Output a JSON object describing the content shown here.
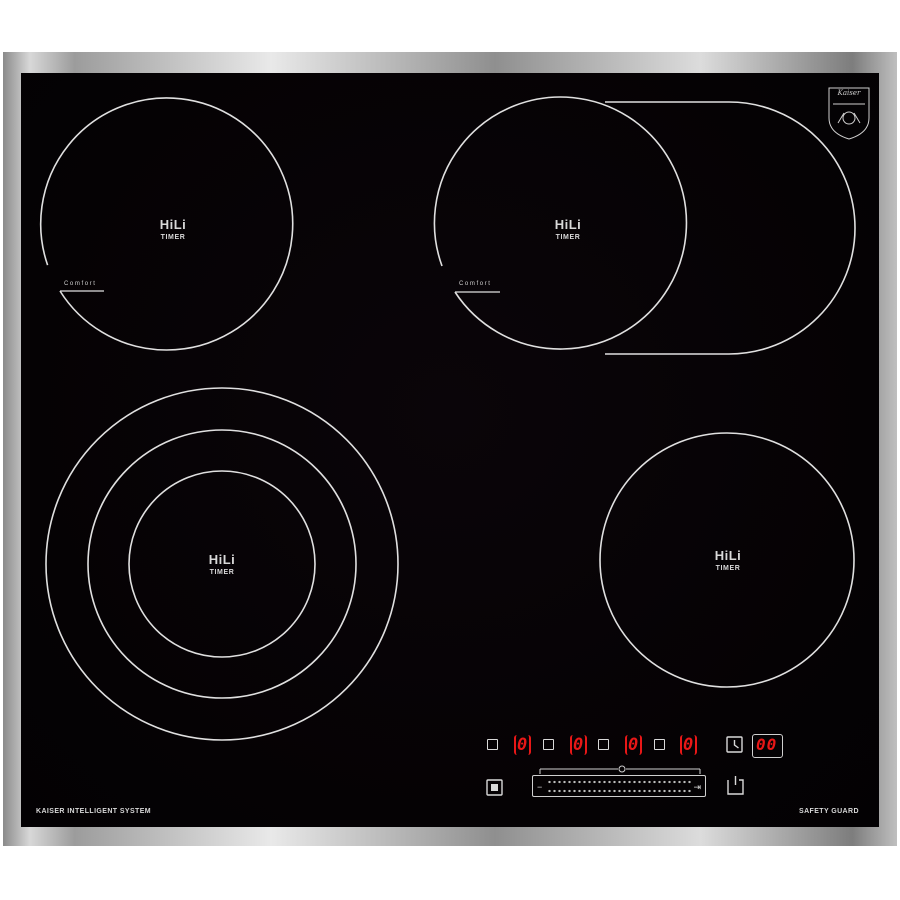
{
  "zones": [
    {
      "id": "front-left",
      "brand": "HiLi",
      "timer_label": "TIMER",
      "comfort_label": "Comfort"
    },
    {
      "id": "back-right",
      "brand": "HiLi",
      "timer_label": "TIMER",
      "comfort_label": "Comfort"
    },
    {
      "id": "bottom-left",
      "brand": "HiLi",
      "timer_label": "TIMER"
    },
    {
      "id": "bottom-right",
      "brand": "HiLi",
      "timer_label": "TIMER"
    }
  ],
  "control_panel": {
    "zone_levels": [
      "0",
      "0",
      "0",
      "0"
    ],
    "timer_value": "00"
  },
  "branding": {
    "left_text": "KAISER INTELLIGENT SYSTEM",
    "right_text": "SAFETY GUARD",
    "logo_text": "Kaiser"
  },
  "colors": {
    "glass": "#050204",
    "lines": "#e0e0e0",
    "display_red": "#e81717"
  }
}
